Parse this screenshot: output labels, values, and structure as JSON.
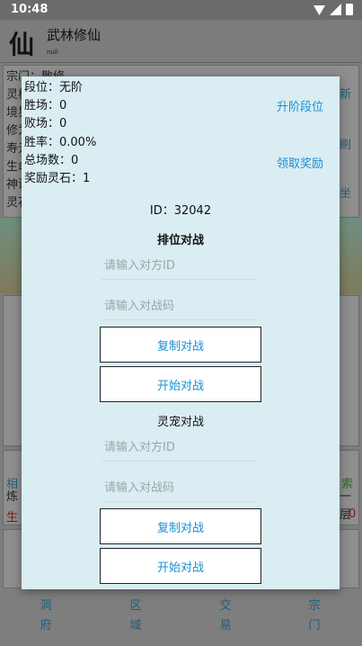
{
  "statusbar": {
    "time": "10:48"
  },
  "app": {
    "logo": "仙",
    "title": "武林修仙",
    "subtitle": "null"
  },
  "background": {
    "info_lines": [
      "宗门：散修",
      "灵根",
      "境界",
      "修为",
      "寿元",
      "生命",
      "神识",
      "灵石"
    ],
    "right_links": [
      "新",
      "刷",
      "坐"
    ],
    "row_left": [
      "相",
      "炼"
    ],
    "row_left_red": "生",
    "row_right": "索",
    "row_right2": "一层",
    "row_right_red": "0"
  },
  "nav": [
    "洞府",
    "区域",
    "交易",
    "宗门"
  ],
  "dialog": {
    "stats": [
      "段位：无阶",
      "胜场：0",
      "败场：0",
      "胜率：0.00%",
      "总场数：0",
      "奖励灵石：1"
    ],
    "upgrade_label": "升阶段位",
    "claim_label": "领取奖励",
    "id_line": "ID：32042",
    "ranked": {
      "title": "排位对战",
      "opponent_id_placeholder": "请输入对方ID",
      "battle_code_placeholder": "请输入对战码",
      "copy_label": "复制对战",
      "start_label": "开始对战"
    },
    "pet": {
      "title": "灵宠对战",
      "opponent_id_placeholder": "请输入对方ID",
      "battle_code_placeholder": "请输入对战码",
      "copy_label": "复制对战",
      "start_label": "开始对战"
    }
  }
}
